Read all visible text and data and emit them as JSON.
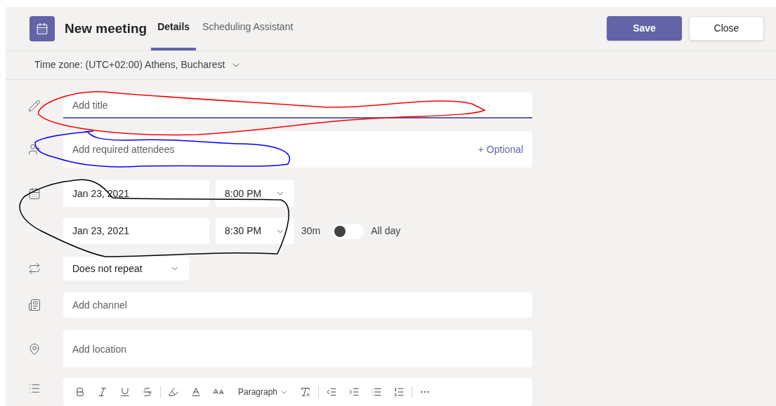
{
  "header": {
    "title": "New meeting",
    "tabs": [
      {
        "label": "Details",
        "selected": true
      },
      {
        "label": "Scheduling Assistant",
        "selected": false
      }
    ],
    "buttons": [
      {
        "label": "Save",
        "kind": "primary"
      },
      {
        "label": "Close",
        "kind": "secondary"
      }
    ]
  },
  "time_zone": "Time zone: (UTC+02:00) Athens, Bucharest",
  "title_field": {
    "placeholder": "Add title"
  },
  "attendees_field": {
    "placeholder": "Add required attendees",
    "optional_link": "+ Optional"
  },
  "start": {
    "date": "Jan 23, 2021",
    "time": "8:00 PM"
  },
  "end": {
    "date": "Jan 23, 2021",
    "time": "8:30 PM"
  },
  "duration": "30m",
  "all_day": {
    "label": "All day",
    "on": false
  },
  "repeat": "Does not repeat",
  "channel_field": {
    "placeholder": "Add channel"
  },
  "location_field": {
    "placeholder": "Add location"
  },
  "editor_toolbar": {
    "paragraph_style": "Paragraph"
  }
}
